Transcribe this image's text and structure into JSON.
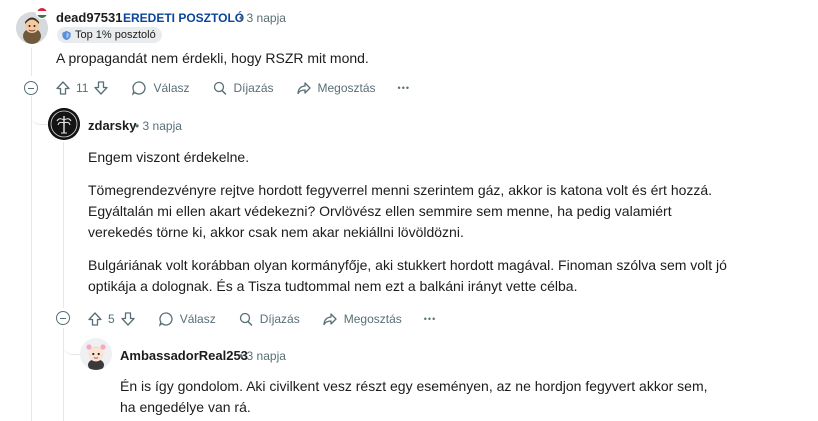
{
  "comments": [
    {
      "username": "dead97531",
      "op_label": "EREDETI POSZTOLÓ",
      "time": "• 3 napja",
      "flair": "Top 1% posztoló",
      "paragraphs": [
        "A propagandát nem érdekli, hogy RSZR mit mond."
      ],
      "score": "11",
      "actions": {
        "reply": "Válasz",
        "award": "Díjazás",
        "share": "Megosztás",
        "more": "•••"
      }
    },
    {
      "username": "zdarsky",
      "time": "• 3 napja",
      "paragraphs": [
        "Engem viszont érdekelne.",
        "Tömegrendezvényre rejtve hordott fegyverrel menni szerintem gáz, akkor is katona volt és ért hozzá. Egyáltalán mi ellen akart védekezni? Orvlövész ellen semmire sem menne, ha pedig valamiért verekedés törne ki, akkor csak nem akar nekiállni lövöldözni.",
        "Bulgáriának volt korábban olyan kormányfője, aki stukkert hordott magával. Finoman szólva sem volt jó optikája a dolognak. És a Tisza tudtommal nem ezt a balkáni irányt vette célba."
      ],
      "score": "5",
      "actions": {
        "reply": "Válasz",
        "award": "Díjazás",
        "share": "Megosztás",
        "more": "•••"
      }
    },
    {
      "username": "AmbassadorReal253",
      "time": "• 3 napja",
      "paragraphs": [
        "Én is így gondolom. Aki civilkent vesz részt egy eseményen, az ne hordjon fegyvert akkor sem, ha engedélye van rá."
      ]
    }
  ],
  "colors": {
    "op": "#0a449b",
    "meta": "#576f76",
    "thread": "#e5e8ea",
    "flair_bg": "#e9ecee"
  }
}
